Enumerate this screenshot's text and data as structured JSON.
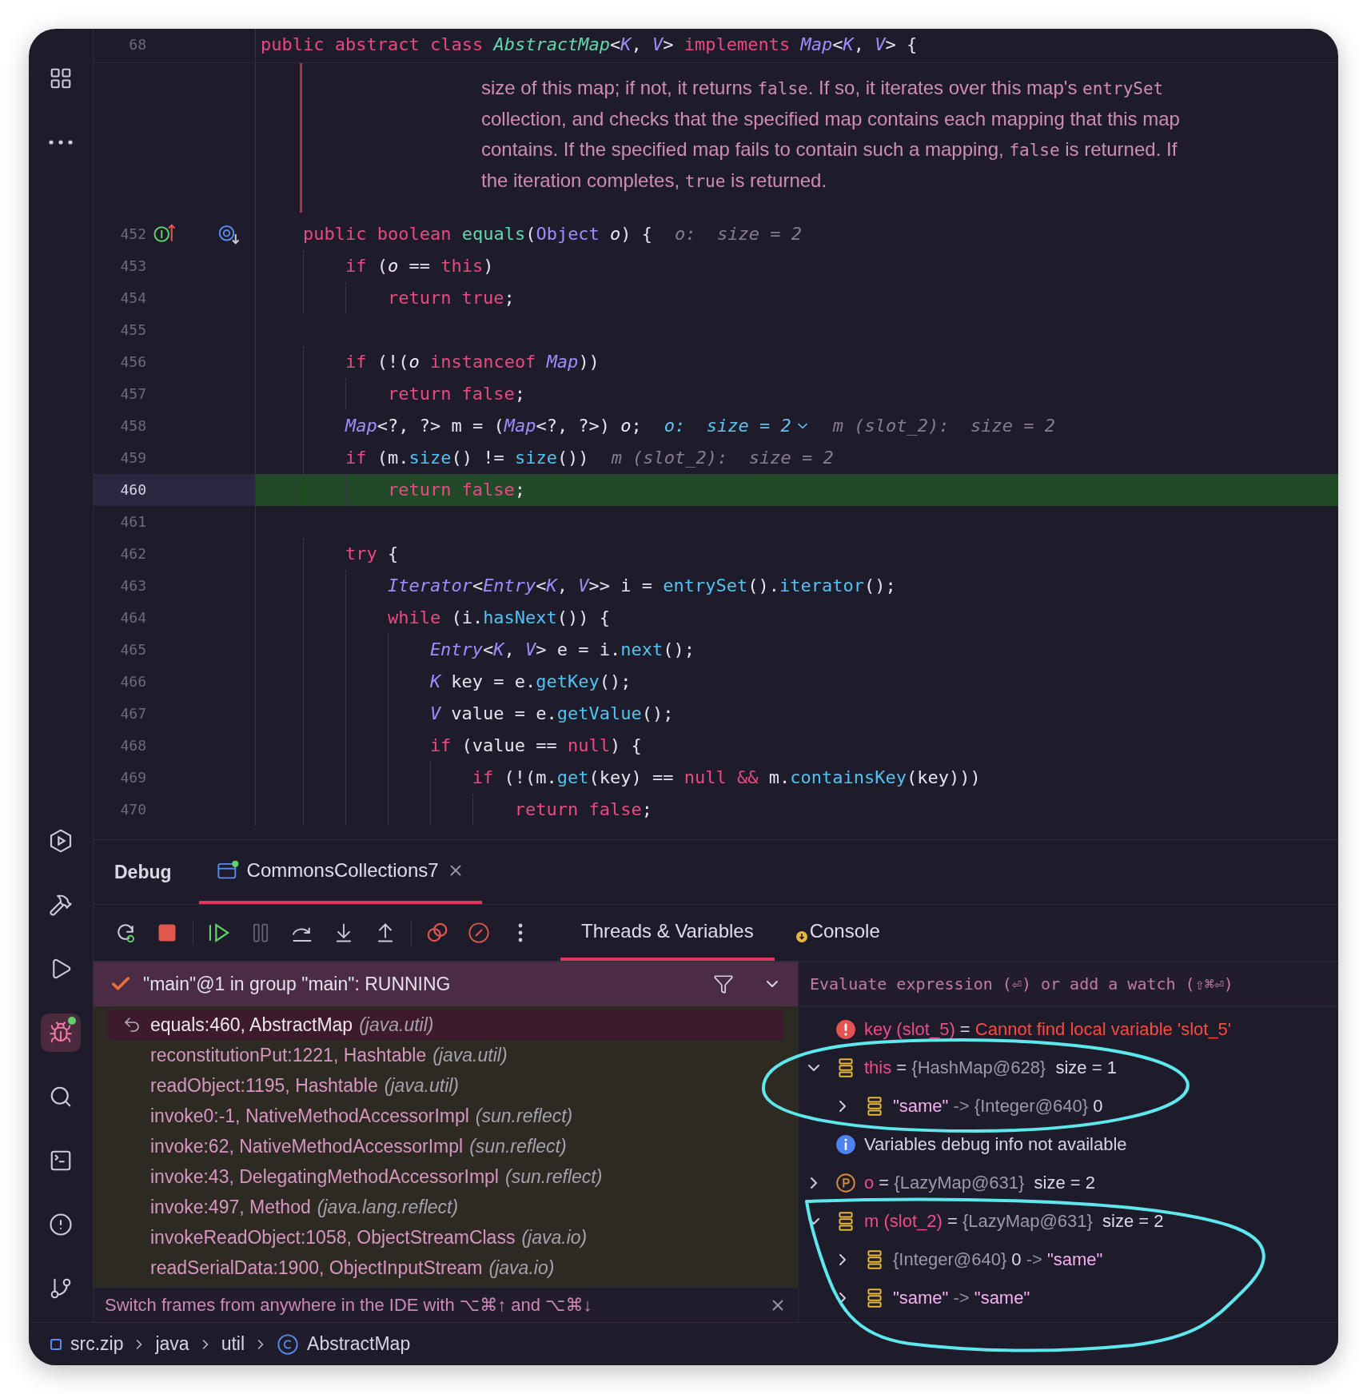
{
  "tool_strip": {
    "top": [
      {
        "kind": "project",
        "selected": false
      },
      {
        "kind": "more",
        "selected": false
      }
    ],
    "bottom": [
      {
        "kind": "services",
        "selected": false
      },
      {
        "kind": "build",
        "selected": false
      },
      {
        "kind": "run",
        "selected": false
      },
      {
        "kind": "debug",
        "selected": true
      },
      {
        "kind": "search",
        "selected": false
      },
      {
        "kind": "terminal",
        "selected": false
      },
      {
        "kind": "problems",
        "selected": false
      },
      {
        "kind": "git",
        "selected": false
      }
    ]
  },
  "editor": {
    "sticky_line": {
      "number": "68",
      "tokens": [
        {
          "text": "public abstract class ",
          "kind": "kw"
        },
        {
          "text": "AbstractMap",
          "kind": "class-decl"
        },
        {
          "text": "<",
          "kind": "plain"
        },
        {
          "text": "K",
          "kind": "type"
        },
        {
          "text": ", ",
          "kind": "plain"
        },
        {
          "text": "V",
          "kind": "type"
        },
        {
          "text": "> ",
          "kind": "plain"
        },
        {
          "text": "implements ",
          "kind": "kw"
        },
        {
          "text": "Map",
          "kind": "type"
        },
        {
          "text": "<",
          "kind": "plain"
        },
        {
          "text": "K",
          "kind": "type"
        },
        {
          "text": ", ",
          "kind": "plain"
        },
        {
          "text": "V",
          "kind": "type"
        },
        {
          "text": "> {",
          "kind": "plain"
        }
      ]
    },
    "doc_comment": {
      "lines": [
        [
          {
            "text": "size of this map; if not, it returns ",
            "kind": "text"
          },
          {
            "text": "false",
            "kind": "code"
          },
          {
            "text": ". If so, it iterates over this map's ",
            "kind": "text"
          },
          {
            "text": "entrySet",
            "kind": "code"
          }
        ],
        [
          {
            "text": "collection, and checks that the specified map contains each mapping that this map",
            "kind": "text"
          }
        ],
        [
          {
            "text": "contains. If the specified map fails to contain such a mapping, ",
            "kind": "text"
          },
          {
            "text": "false",
            "kind": "code"
          },
          {
            "text": " is returned. If",
            "kind": "text"
          }
        ],
        [
          {
            "text": "the iteration completes, ",
            "kind": "text"
          },
          {
            "text": "true",
            "kind": "code"
          },
          {
            "text": " is returned.",
            "kind": "text"
          }
        ]
      ]
    },
    "lines": [
      {
        "number": "452",
        "current": false,
        "markers": [
          {
            "kind": "implements"
          },
          {
            "kind": "overridden"
          }
        ],
        "tokens": [
          {
            "text": "    public boolean ",
            "kind": "kw"
          },
          {
            "text": "equals",
            "kind": "method-decl"
          },
          {
            "text": "(",
            "kind": "plain"
          },
          {
            "text": "Object ",
            "kind": "cls"
          },
          {
            "text": "o",
            "kind": "param"
          },
          {
            "text": ") {",
            "kind": "plain"
          }
        ],
        "hints": [
          {
            "text": "o:  size = 2",
            "active": false,
            "expandable": false
          }
        ]
      },
      {
        "number": "453",
        "current": false,
        "tokens": [
          {
            "text": "        if",
            "kind": "kw"
          },
          {
            "text": " (",
            "kind": "plain"
          },
          {
            "text": "o",
            "kind": "param"
          },
          {
            "text": " == ",
            "kind": "plain"
          },
          {
            "text": "this",
            "kind": "kw"
          },
          {
            "text": ")",
            "kind": "plain"
          }
        ]
      },
      {
        "number": "454",
        "current": false,
        "tokens": [
          {
            "text": "            return true",
            "kind": "kw"
          },
          {
            "text": ";",
            "kind": "plain"
          }
        ]
      },
      {
        "number": "455",
        "current": false
      },
      {
        "number": "456",
        "current": false,
        "tokens": [
          {
            "text": "        if",
            "kind": "kw"
          },
          {
            "text": " (!(",
            "kind": "plain"
          },
          {
            "text": "o",
            "kind": "param"
          },
          {
            "text": " instanceof ",
            "kind": "kw"
          },
          {
            "text": "Map",
            "kind": "type"
          },
          {
            "text": "))",
            "kind": "plain"
          }
        ]
      },
      {
        "number": "457",
        "current": false,
        "tokens": [
          {
            "text": "            return false",
            "kind": "kw"
          },
          {
            "text": ";",
            "kind": "plain"
          }
        ]
      },
      {
        "number": "458",
        "current": false,
        "tokens": [
          {
            "text": "        Map",
            "kind": "type"
          },
          {
            "text": "<?, ?> m = (",
            "kind": "plain"
          },
          {
            "text": "Map",
            "kind": "type"
          },
          {
            "text": "<?, ?>) ",
            "kind": "plain"
          },
          {
            "text": "o",
            "kind": "param"
          },
          {
            "text": ";",
            "kind": "plain"
          }
        ],
        "hints": [
          {
            "text": "o:  size = 2",
            "active": true,
            "expandable": true
          },
          {
            "text": "m (slot_2):  size = 2",
            "active": false,
            "expandable": false
          }
        ]
      },
      {
        "number": "459",
        "current": false,
        "tokens": [
          {
            "text": "        if",
            "kind": "kw"
          },
          {
            "text": " (m.",
            "kind": "plain"
          },
          {
            "text": "size",
            "kind": "call"
          },
          {
            "text": "() != ",
            "kind": "plain"
          },
          {
            "text": "size",
            "kind": "call"
          },
          {
            "text": "())",
            "kind": "plain"
          }
        ],
        "hints": [
          {
            "text": "m (slot_2):  size = 2",
            "active": false,
            "expandable": false
          }
        ]
      },
      {
        "number": "460",
        "current": true,
        "tokens": [
          {
            "text": "            return false",
            "kind": "kw"
          },
          {
            "text": ";",
            "kind": "plain"
          }
        ]
      },
      {
        "number": "461",
        "current": false
      },
      {
        "number": "462",
        "current": false,
        "tokens": [
          {
            "text": "        try",
            "kind": "kw"
          },
          {
            "text": " {",
            "kind": "plain"
          }
        ]
      },
      {
        "number": "463",
        "current": false,
        "tokens": [
          {
            "text": "            Iterator",
            "kind": "type"
          },
          {
            "text": "<",
            "kind": "plain"
          },
          {
            "text": "Entry",
            "kind": "type"
          },
          {
            "text": "<",
            "kind": "plain"
          },
          {
            "text": "K",
            "kind": "type"
          },
          {
            "text": ", ",
            "kind": "plain"
          },
          {
            "text": "V",
            "kind": "type"
          },
          {
            "text": ">> i = ",
            "kind": "plain"
          },
          {
            "text": "entrySet",
            "kind": "call"
          },
          {
            "text": "().",
            "kind": "plain"
          },
          {
            "text": "iterator",
            "kind": "call"
          },
          {
            "text": "();",
            "kind": "plain"
          }
        ]
      },
      {
        "number": "464",
        "current": false,
        "tokens": [
          {
            "text": "            while",
            "kind": "kw"
          },
          {
            "text": " (i.",
            "kind": "plain"
          },
          {
            "text": "hasNext",
            "kind": "call"
          },
          {
            "text": "()) {",
            "kind": "plain"
          }
        ]
      },
      {
        "number": "465",
        "current": false,
        "tokens": [
          {
            "text": "                Entry",
            "kind": "type"
          },
          {
            "text": "<",
            "kind": "plain"
          },
          {
            "text": "K",
            "kind": "type"
          },
          {
            "text": ", ",
            "kind": "plain"
          },
          {
            "text": "V",
            "kind": "type"
          },
          {
            "text": "> e = i.",
            "kind": "plain"
          },
          {
            "text": "next",
            "kind": "call"
          },
          {
            "text": "();",
            "kind": "plain"
          }
        ]
      },
      {
        "number": "466",
        "current": false,
        "tokens": [
          {
            "text": "                K",
            "kind": "type"
          },
          {
            "text": " key = e.",
            "kind": "plain"
          },
          {
            "text": "getKey",
            "kind": "call"
          },
          {
            "text": "();",
            "kind": "plain"
          }
        ]
      },
      {
        "number": "467",
        "current": false,
        "tokens": [
          {
            "text": "                V",
            "kind": "type"
          },
          {
            "text": " value = e.",
            "kind": "plain"
          },
          {
            "text": "getValue",
            "kind": "call"
          },
          {
            "text": "();",
            "kind": "plain"
          }
        ]
      },
      {
        "number": "468",
        "current": false,
        "tokens": [
          {
            "text": "                if",
            "kind": "kw"
          },
          {
            "text": " (value == ",
            "kind": "plain"
          },
          {
            "text": "null",
            "kind": "kw"
          },
          {
            "text": ") {",
            "kind": "plain"
          }
        ]
      },
      {
        "number": "469",
        "current": false,
        "tokens": [
          {
            "text": "                    if",
            "kind": "kw"
          },
          {
            "text": " (!(m.",
            "kind": "plain"
          },
          {
            "text": "get",
            "kind": "call"
          },
          {
            "text": "(key) == ",
            "kind": "plain"
          },
          {
            "text": "null",
            "kind": "kw"
          },
          {
            "text": " &&",
            "kind": "kw"
          },
          {
            "text": " m.",
            "kind": "plain"
          },
          {
            "text": "containsKey",
            "kind": "call"
          },
          {
            "text": "(key)))",
            "kind": "plain"
          }
        ]
      },
      {
        "number": "470",
        "current": false,
        "tokens": [
          {
            "text": "                        return false",
            "kind": "kw"
          },
          {
            "text": ";",
            "kind": "plain"
          }
        ]
      }
    ]
  },
  "debug": {
    "title": "Debug",
    "tabs": [
      {
        "label": "CommonsCollections7",
        "selected": true
      }
    ],
    "toolbar": [
      {
        "kind": "rerun",
        "disabled": false
      },
      {
        "kind": "stop",
        "disabled": false
      },
      {
        "kind": "resume",
        "disabled": false
      },
      {
        "kind": "pause",
        "disabled": true
      },
      {
        "kind": "step-over",
        "disabled": false
      },
      {
        "kind": "step-into",
        "disabled": false
      },
      {
        "kind": "step-out",
        "disabled": false
      },
      {
        "kind": "breakpoints",
        "disabled": false
      },
      {
        "kind": "mute",
        "disabled": false
      },
      {
        "kind": "more",
        "disabled": false
      }
    ],
    "view_tabs": [
      {
        "label": "Threads & Variables",
        "selected": true,
        "kind": "plain"
      },
      {
        "label": "Console",
        "selected": false,
        "kind": "badge"
      }
    ],
    "thread": {
      "label": "\"main\"@1 in group \"main\": RUNNING"
    },
    "frames": [
      {
        "method": "equals:460, AbstractMap",
        "package": "(java.util)",
        "selected": true
      },
      {
        "method": "reconstitutionPut:1221, Hashtable",
        "package": "(java.util)",
        "selected": false
      },
      {
        "method": "readObject:1195, Hashtable",
        "package": "(java.util)",
        "selected": false
      },
      {
        "method": "invoke0:-1, NativeMethodAccessorImpl",
        "package": "(sun.reflect)",
        "selected": false
      },
      {
        "method": "invoke:62, NativeMethodAccessorImpl",
        "package": "(sun.reflect)",
        "selected": false
      },
      {
        "method": "invoke:43, DelegatingMethodAccessorImpl",
        "package": "(sun.reflect)",
        "selected": false
      },
      {
        "method": "invoke:497, Method",
        "package": "(java.lang.reflect)",
        "selected": false
      },
      {
        "method": "invokeReadObject:1058, ObjectStreamClass",
        "package": "(java.io)",
        "selected": false
      },
      {
        "method": "readSerialData:1900, ObjectInputStream",
        "package": "(java.io)",
        "selected": false
      }
    ],
    "hint": "Switch frames from anywhere in the IDE with ⌥⌘↑ and ⌥⌘↓",
    "evaluate": {
      "placeholder": "Evaluate expression (⏎) or add a watch (⇧⌘⏎)"
    },
    "variables": [
      {
        "kind": "error",
        "parts": [
          {
            "text": "key (slot_5)",
            "kind": "name"
          },
          {
            "text": " = ",
            "kind": "plain"
          },
          {
            "text": "Cannot find local variable 'slot_5'",
            "kind": "error"
          }
        ]
      },
      {
        "kind": "field",
        "expanded": true,
        "parts": [
          {
            "text": "this",
            "kind": "name"
          },
          {
            "text": " = ",
            "kind": "plain"
          },
          {
            "text": "{HashMap@628}",
            "kind": "ref"
          },
          {
            "text": "  size = 1",
            "kind": "plain"
          }
        ],
        "children": [
          {
            "kind": "field",
            "expanded": false,
            "parts": [
              {
                "text": "\"same\"",
                "kind": "str"
              },
              {
                "text": " -> ",
                "kind": "arrow"
              },
              {
                "text": "{Integer@640}",
                "kind": "ref"
              },
              {
                "text": " 0",
                "kind": "plain"
              }
            ]
          }
        ]
      },
      {
        "kind": "info",
        "parts": [
          {
            "text": "Variables debug info not available",
            "kind": "info"
          }
        ]
      },
      {
        "kind": "param",
        "expanded": false,
        "parts": [
          {
            "text": "o",
            "kind": "name"
          },
          {
            "text": " = ",
            "kind": "plain"
          },
          {
            "text": "{LazyMap@631}",
            "kind": "ref"
          },
          {
            "text": "  size = 2",
            "kind": "plain"
          }
        ]
      },
      {
        "kind": "field",
        "expanded": true,
        "parts": [
          {
            "text": "m (slot_2)",
            "kind": "name"
          },
          {
            "text": " = ",
            "kind": "plain"
          },
          {
            "text": "{LazyMap@631}",
            "kind": "ref"
          },
          {
            "text": "  size = 2",
            "kind": "plain"
          }
        ],
        "children": [
          {
            "kind": "field",
            "expanded": false,
            "parts": [
              {
                "text": "{Integer@640}",
                "kind": "ref"
              },
              {
                "text": " 0",
                "kind": "plain"
              },
              {
                "text": " -> ",
                "kind": "arrow"
              },
              {
                "text": "\"same\"",
                "kind": "str"
              }
            ]
          },
          {
            "kind": "field",
            "expanded": false,
            "parts": [
              {
                "text": "\"same\"",
                "kind": "str"
              },
              {
                "text": " -> ",
                "kind": "arrow"
              },
              {
                "text": "\"same\"",
                "kind": "str"
              }
            ]
          }
        ]
      }
    ]
  },
  "breadcrumbs": [
    {
      "text": "src.zip",
      "kind": "archive"
    },
    {
      "text": "java",
      "kind": "package"
    },
    {
      "text": "util",
      "kind": "package"
    },
    {
      "text": "AbstractMap",
      "kind": "class"
    }
  ]
}
